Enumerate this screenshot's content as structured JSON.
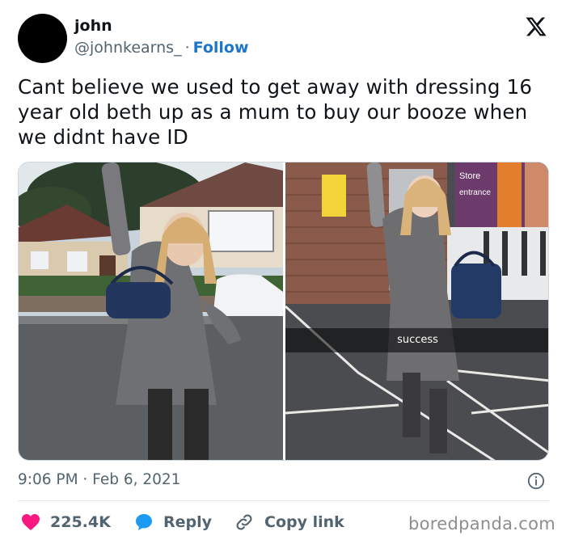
{
  "user": {
    "name": "john",
    "handle": "@johnkearns_",
    "separator": "·",
    "follow_label": "Follow"
  },
  "tweet": {
    "text": "Cant believe we used to get away with dressing 16 year old beth up as a mum to buy our booze when we didnt have ID",
    "timestamp": "9:06 PM · Feb 6, 2021"
  },
  "media": {
    "left_photo_icon": "photo-of-girl-in-coat-street",
    "right_photo_icon": "photo-of-girl-in-parking-lot",
    "store_sign": "Store entrance",
    "snap_caption": "success"
  },
  "actions": {
    "like_count": "225.4K",
    "reply_label": "Reply",
    "copy_label": "Copy link"
  },
  "watermark": "boredpanda.com",
  "colors": {
    "accent": "#1d76cc",
    "like": "#f91880",
    "reply": "#1d9bf0",
    "muted": "#536471"
  },
  "icons": [
    "x-logo-icon",
    "info-icon",
    "heart-icon",
    "reply-bubble-icon",
    "link-icon"
  ]
}
